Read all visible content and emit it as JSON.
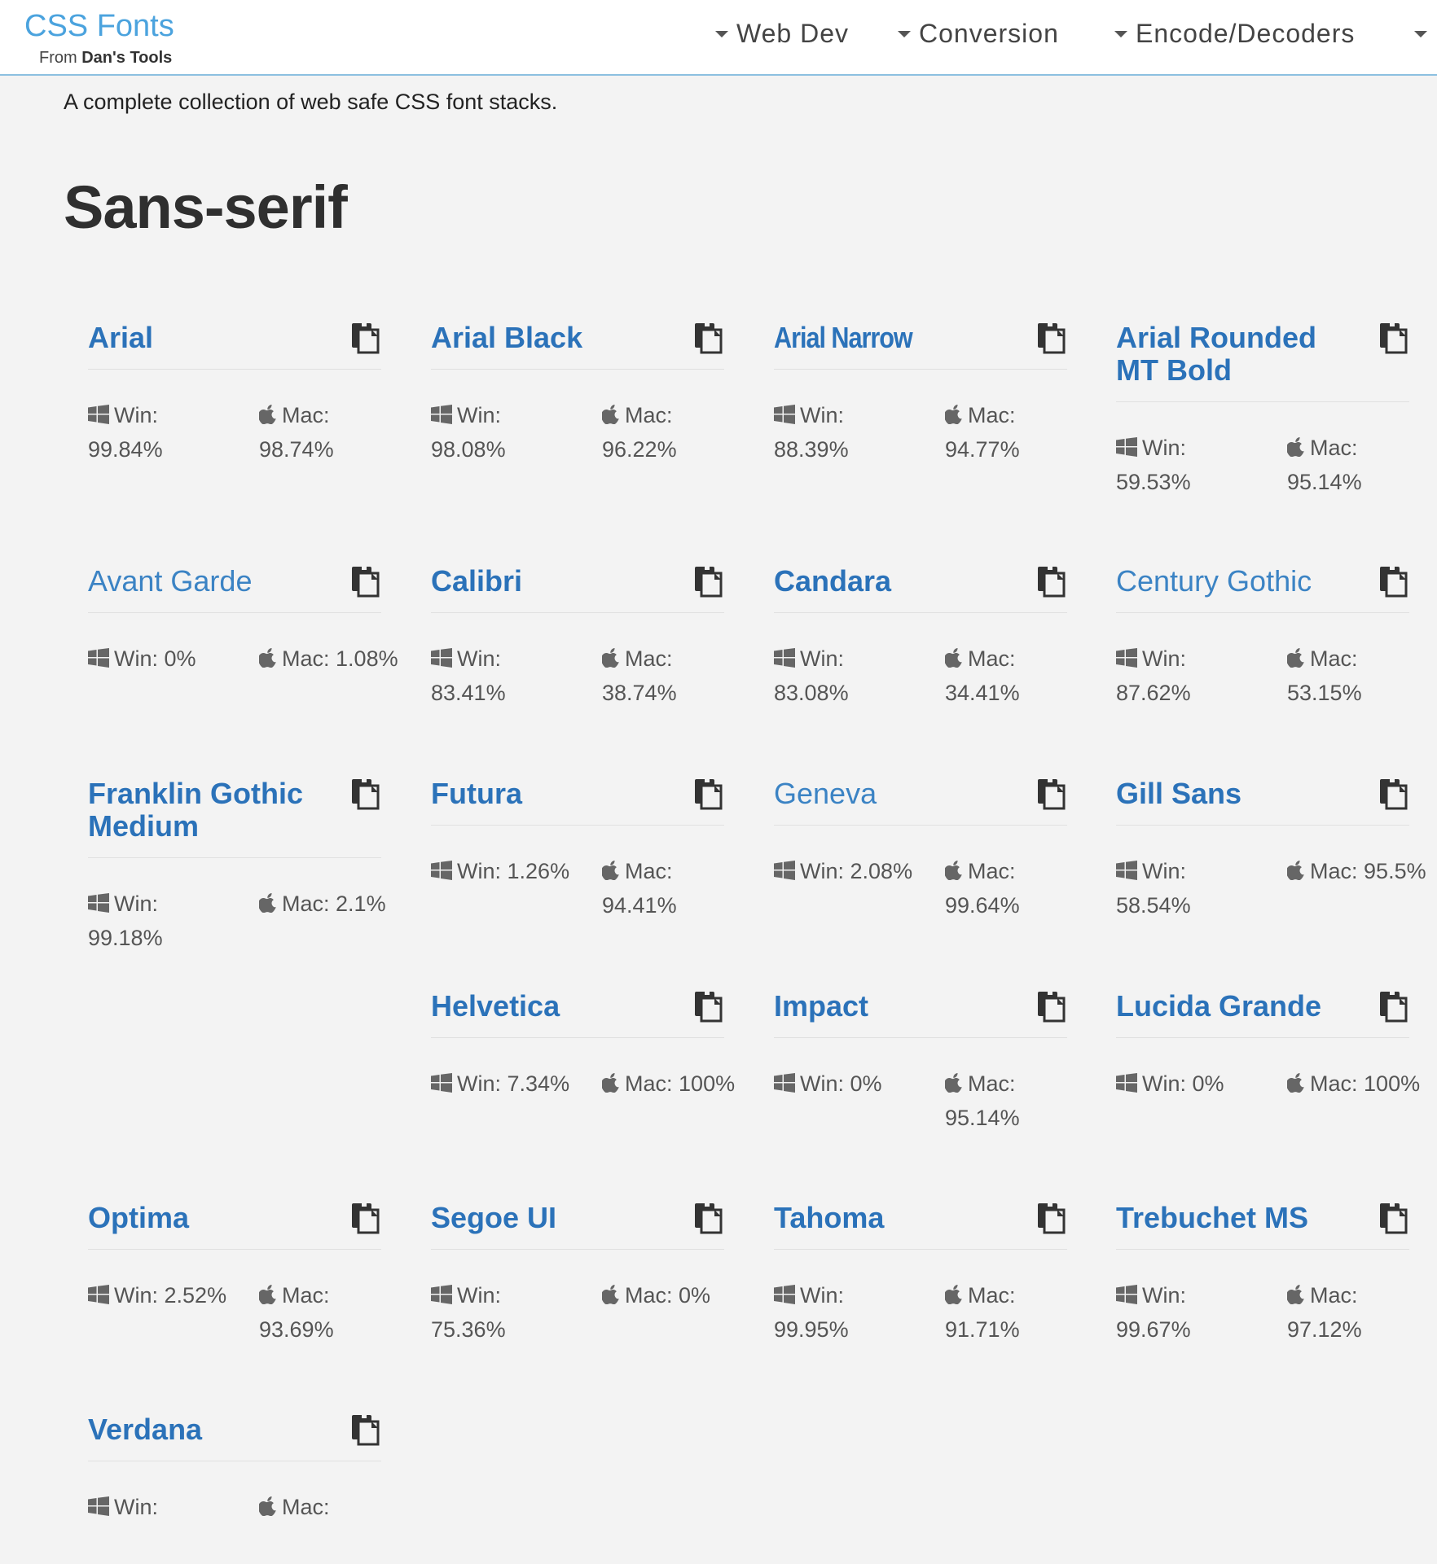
{
  "header": {
    "brand_title": "CSS Fonts",
    "brand_sub_prefix": "From",
    "brand_sub_name": "Dan's Tools",
    "nav": [
      "Web Dev",
      "Conversion",
      "Encode/Decoders"
    ]
  },
  "intro": "A complete collection of web safe CSS font stacks.",
  "section_title": "Sans-serif",
  "labels": {
    "win": "Win:",
    "mac": "Mac:"
  },
  "fonts": [
    {
      "name": "Arial",
      "win": "99.84%",
      "mac": "98.74%"
    },
    {
      "name": "Arial Black",
      "win": "98.08%",
      "mac": "96.22%"
    },
    {
      "name": "Arial Narrow",
      "win": "88.39%",
      "mac": "94.77%"
    },
    {
      "name": "Arial Rounded MT Bold",
      "win": "59.53%",
      "mac": "95.14%"
    },
    {
      "name": "Avant Garde",
      "win": "0%",
      "mac": "1.08%"
    },
    {
      "name": "Calibri",
      "win": "83.41%",
      "mac": "38.74%"
    },
    {
      "name": "Candara",
      "win": "83.08%",
      "mac": "34.41%"
    },
    {
      "name": "Century Gothic",
      "win": "87.62%",
      "mac": "53.15%"
    },
    {
      "name": "Franklin Gothic Medium",
      "win": "99.18%",
      "mac": "2.1%"
    },
    {
      "name": "Futura",
      "win": "1.26%",
      "mac": "94.41%"
    },
    {
      "name": "Geneva",
      "win": "2.08%",
      "mac": "99.64%"
    },
    {
      "name": "Gill Sans",
      "win": "58.54%",
      "mac": "95.5%"
    },
    {
      "name": "Helvetica",
      "win": "7.34%",
      "mac": "100%"
    },
    {
      "name": "Impact",
      "win": "0%",
      "mac": "95.14%"
    },
    {
      "name": "Lucida Grande",
      "win": "0%",
      "mac": "100%"
    },
    {
      "name": "Optima",
      "win": "2.52%",
      "mac": "93.69%"
    },
    {
      "name": "Segoe UI",
      "win": "75.36%",
      "mac": "0%"
    },
    {
      "name": "Tahoma",
      "win": "99.95%",
      "mac": "91.71%"
    },
    {
      "name": "Trebuchet MS",
      "win": "99.67%",
      "mac": "97.12%"
    },
    {
      "name": "Verdana",
      "win": "",
      "mac": ""
    }
  ],
  "icons": {
    "win": "windows-icon",
    "mac": "apple-icon",
    "copy": "copy-icon"
  }
}
